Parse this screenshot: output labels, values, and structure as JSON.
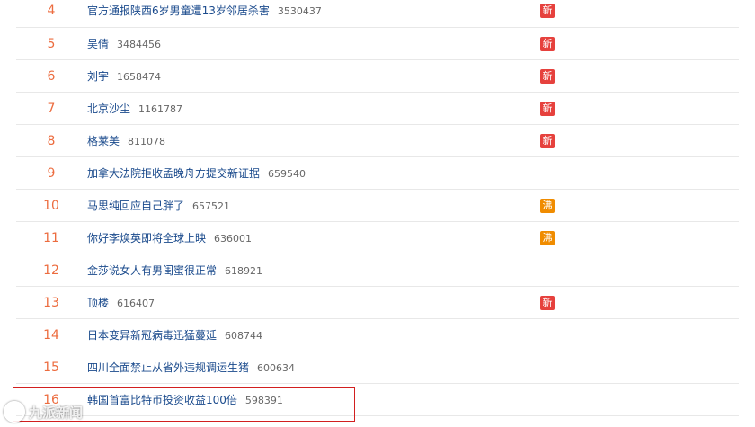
{
  "hot_list": [
    {
      "rank": "4",
      "title": "官方通报陕西6岁男童遭13岁邻居杀害",
      "heat": "3530437",
      "badge": "新"
    },
    {
      "rank": "5",
      "title": "吴倩",
      "heat": "3484456",
      "badge": "新"
    },
    {
      "rank": "6",
      "title": "刘宇",
      "heat": "1658474",
      "badge": "新"
    },
    {
      "rank": "7",
      "title": "北京沙尘",
      "heat": "1161787",
      "badge": "新"
    },
    {
      "rank": "8",
      "title": "格莱美",
      "heat": "811078",
      "badge": "新"
    },
    {
      "rank": "9",
      "title": "加拿大法院拒收孟晚舟方提交新证据",
      "heat": "659540",
      "badge": ""
    },
    {
      "rank": "10",
      "title": "马思纯回应自己胖了",
      "heat": "657521",
      "badge": "沸"
    },
    {
      "rank": "11",
      "title": "你好李焕英即将全球上映",
      "heat": "636001",
      "badge": "沸"
    },
    {
      "rank": "12",
      "title": "金莎说女人有男闺蜜很正常",
      "heat": "618921",
      "badge": ""
    },
    {
      "rank": "13",
      "title": "顶楼",
      "heat": "616407",
      "badge": "新"
    },
    {
      "rank": "14",
      "title": "日本变异新冠病毒迅猛蔓延",
      "heat": "608744",
      "badge": ""
    },
    {
      "rank": "15",
      "title": "四川全面禁止从省外违规调运生猪",
      "heat": "600634",
      "badge": ""
    },
    {
      "rank": "16",
      "title": "韩国首富比特币投资收益100倍",
      "heat": "598391",
      "badge": ""
    }
  ],
  "watermark": {
    "text": "九派新闻"
  },
  "colors": {
    "rank": "#ec6c3f",
    "title": "#1a4a8c",
    "new_badge": "#e6413d",
    "hot_badge": "#f08c00",
    "highlight": "#d21f1f"
  }
}
